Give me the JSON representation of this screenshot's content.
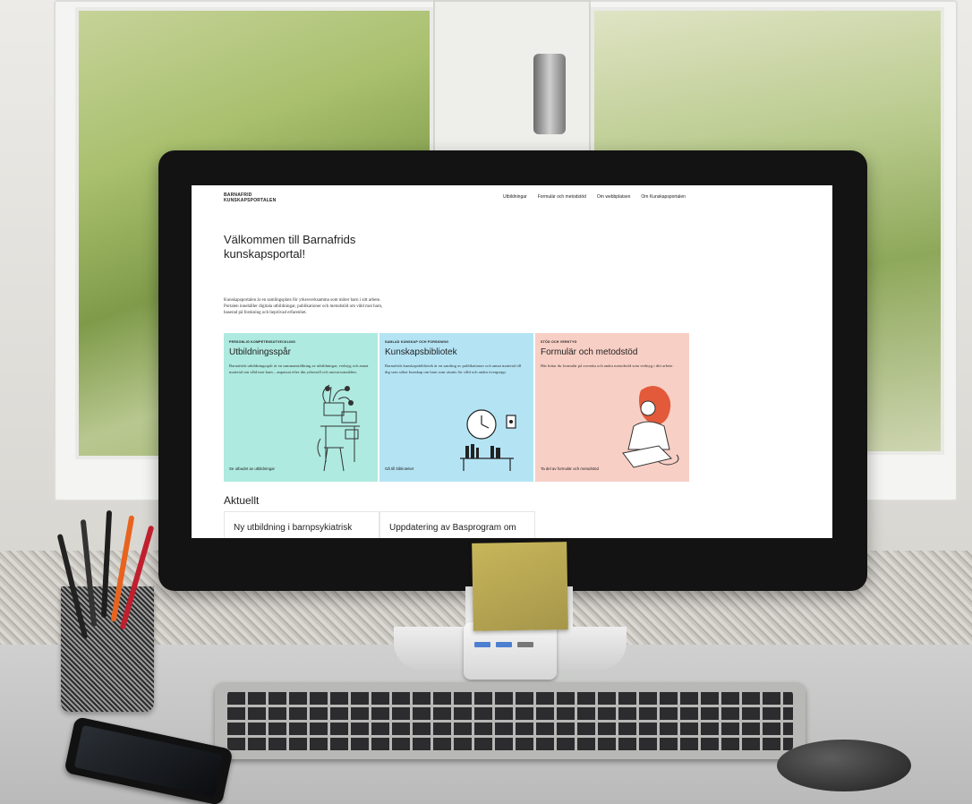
{
  "site": {
    "logo_line1": "BARNAFRID",
    "logo_line2": "KUNSKAPSPORTALEN",
    "nav": [
      {
        "label": "Utbildningar"
      },
      {
        "label": "Formulär och metodstöd"
      },
      {
        "label": "Om webbplatsen"
      },
      {
        "label": "Om Kunskapsportalen"
      }
    ],
    "hero_title": "Välkommen till Barnafrids kunskapsportal!",
    "intro": "Kunskapsportalen är en samlingsplats för yrkesverksamma som möter barn i sitt arbete. Portalen innehåller digitala utbildningar, publikationer och metodstöd om våld mot barn, baserad på forskning och beprövad erfarenhet.",
    "cards": [
      {
        "eyebrow": "PERSONLIG KOMPETENSUTVECKLING",
        "title": "Utbildningsspår",
        "desc": "Barnafrids utbildningsspår är en sammanställning av utbildningar, verktyg och annat material om våld mot barn – anpassat efter din yrkesroll och ansvarsområden.",
        "link": "Se utbudet av utbildningar",
        "color": "#aeeadf"
      },
      {
        "eyebrow": "SAMLAD KUNSKAP OCH FORSKNING",
        "title": "Kunskapsbibliotek",
        "desc": "Barnafrids kunskapsbibliotek är en samling av publikationer och annat material till dig som söker kunskap om barn som utsatts för våld och andra övergrepp.",
        "link": "Gå till biblioteket",
        "color": "#b4e4f4"
      },
      {
        "eyebrow": "STÖD OCH VERKTYG",
        "title": "Formulär och metodstöd",
        "desc": "Här hittar du formulär på svenska och andra metodstöd som verktyg i ditt arbete.",
        "link": "Ta del av formulär och metodstöd",
        "color": "#f8cfc5"
      }
    ],
    "news_heading": "Aktuellt",
    "news": [
      {
        "title": "Ny utbildning i barnpsykiatrisk"
      },
      {
        "title": "Uppdatering av Basprogram om"
      }
    ]
  },
  "scene_colors": {
    "monitor_bezel": "#131313",
    "sticky_note": "#b8a652",
    "hub_port": "#4d7fd0"
  }
}
